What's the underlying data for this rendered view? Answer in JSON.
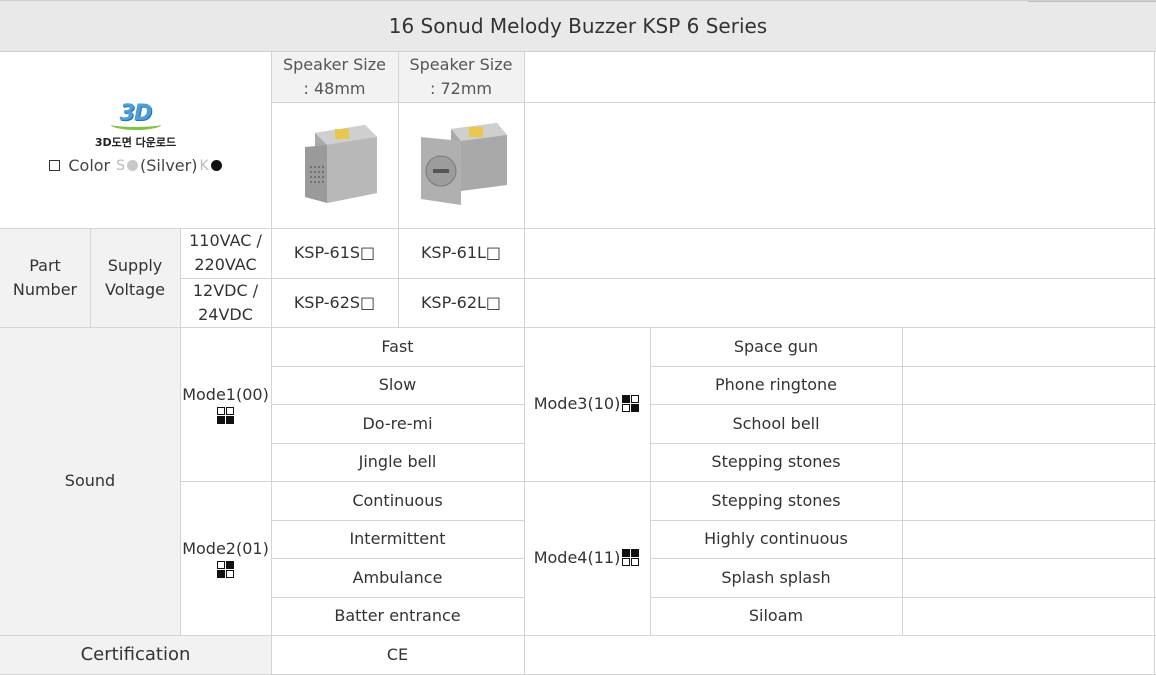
{
  "title": "16 Sonud Melody Buzzer KSP 6 Series",
  "header": {
    "logo_text": "3D",
    "logo_caption": "3D도면 다운로드",
    "color_label": "Color",
    "color_s_letter": "S",
    "color_silver_label": "(Silver)",
    "color_k_letter": "K",
    "speaker_48": "Speaker Size : 48mm",
    "speaker_72": "Speaker Size : 72mm"
  },
  "part": {
    "label": "Part Number",
    "supply_label": "Supply Voltage",
    "rows": [
      {
        "voltage": "110VAC / 220VAC",
        "model_48": "KSP-61S□",
        "model_72": "KSP-61L□"
      },
      {
        "voltage": "12VDC / 24VDC",
        "model_48": "KSP-62S□",
        "model_72": "KSP-62L□"
      }
    ]
  },
  "sound": {
    "label": "Sound",
    "modes": [
      {
        "name": "Mode1(00)",
        "pattern": [
          0,
          0,
          1,
          1
        ],
        "items": [
          "Fast",
          "Slow",
          "Do-re-mi",
          "Jingle bell"
        ]
      },
      {
        "name": "Mode2(01)",
        "pattern": [
          0,
          1,
          1,
          0
        ],
        "items": [
          "Continuous",
          "Intermittent",
          "Ambulance",
          "Batter entrance"
        ]
      },
      {
        "name": "Mode3(10)",
        "pattern": [
          1,
          0,
          0,
          1
        ],
        "items": [
          "Space gun",
          "Phone ringtone",
          "School bell",
          "Stepping stones"
        ]
      },
      {
        "name": "Mode4(11)",
        "pattern": [
          1,
          1,
          0,
          0
        ],
        "items": [
          "Stepping stones",
          "Highly continuous",
          "Splash splash",
          "Siloam"
        ]
      }
    ]
  },
  "certification": {
    "label": "Certification",
    "value": "CE"
  },
  "colors": {
    "silver_dot": "#c8c8c8",
    "black_dot": "#111111",
    "header_bg": "#e9e9e9",
    "label_bg": "#f2f2f2"
  }
}
